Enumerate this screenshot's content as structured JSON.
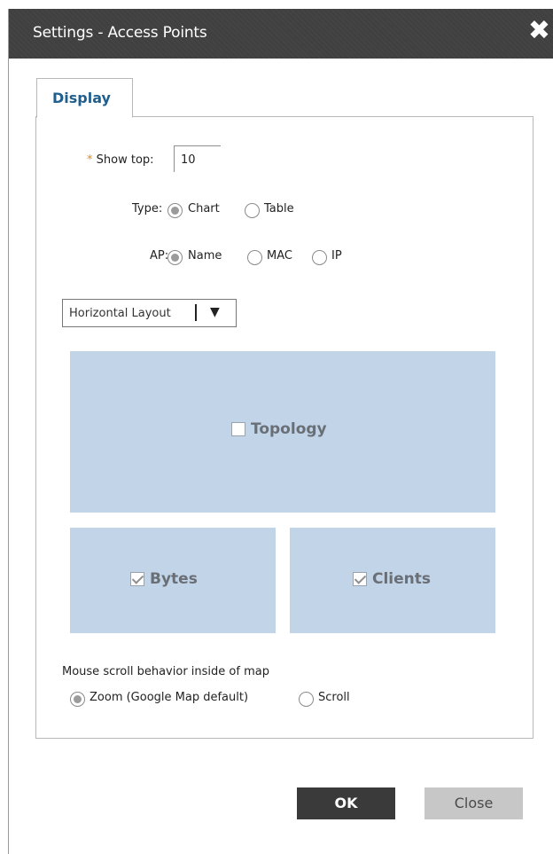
{
  "dialog": {
    "title": "Settings - Access Points",
    "close_glyph": "✖"
  },
  "tabs": [
    {
      "label": "Display",
      "active": true
    }
  ],
  "form": {
    "show_top": {
      "required_mark": "*",
      "label": "Show top:",
      "value": "10"
    },
    "type": {
      "label": "Type:",
      "options": [
        "Chart",
        "Table"
      ],
      "selected": "Chart"
    },
    "ap": {
      "label": "AP:",
      "options": [
        "Name",
        "MAC",
        "IP"
      ],
      "selected": "Name"
    },
    "layout": {
      "value": "Horizontal Layout",
      "arrow_glyph": "▼"
    }
  },
  "tiles": {
    "topology": {
      "label": "Topology",
      "checked": false
    },
    "bytes": {
      "label": "Bytes",
      "checked": true
    },
    "clients": {
      "label": "Clients",
      "checked": true
    }
  },
  "mouse_scroll": {
    "label": "Mouse scroll behavior inside of map",
    "options": [
      "Zoom (Google Map default)",
      "Scroll"
    ],
    "selected": "Zoom (Google Map default)"
  },
  "buttons": {
    "ok": "OK",
    "close": "Close"
  },
  "colors": {
    "titlebar": "#404040",
    "tab_text": "#1f5f8f",
    "required": "#e08a1e",
    "tile": "#c2d4e8",
    "ok_button": "#3a3a3a",
    "close_button": "#c7c7c7"
  }
}
